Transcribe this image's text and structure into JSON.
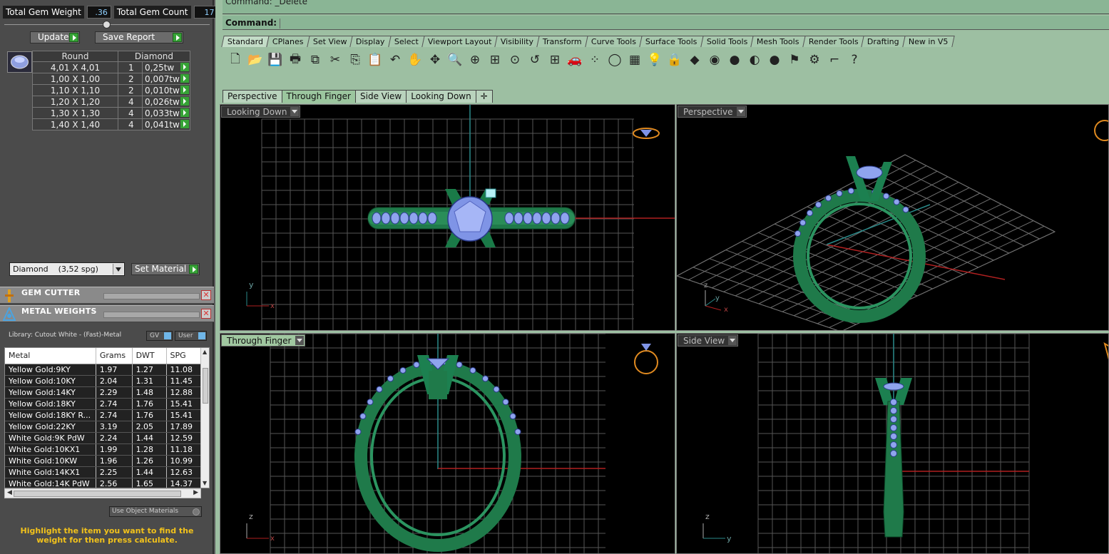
{
  "totals": {
    "weight_label": "Total Gem Weight",
    "weight_value": ".36",
    "count_label": "Total Gem Count",
    "count_value": "17"
  },
  "buttons": {
    "update": "Update",
    "save_report": "Save Report",
    "set_material": "Set Material"
  },
  "gem_table": {
    "headers": [
      "Round",
      "Diamond"
    ],
    "rows": [
      {
        "size": "4,01 X 4,01",
        "count": "1",
        "weight": "0,25tw"
      },
      {
        "size": "1,00 X 1,00",
        "count": "2",
        "weight": "0,007tw"
      },
      {
        "size": "1,10 X 1,10",
        "count": "2",
        "weight": "0,010tw"
      },
      {
        "size": "1,20 X 1,20",
        "count": "4",
        "weight": "0,026tw"
      },
      {
        "size": "1,30 X 1,30",
        "count": "4",
        "weight": "0,033tw"
      },
      {
        "size": "1,40 X 1,40",
        "count": "4",
        "weight": "0,041tw"
      }
    ]
  },
  "material_select": {
    "value": "Diamond    (3,52 spg)"
  },
  "panels": {
    "gem_cutter": "GEM CUTTER",
    "metal_weights": "METAL WEIGHTS"
  },
  "metal": {
    "library": "Library: Cutout White - (Fast)-Metal",
    "gv_label": "GV",
    "user_label": "User",
    "headers": [
      "Metal",
      "Grams",
      "DWT",
      "SPG"
    ],
    "rows": [
      {
        "name": "Yellow Gold:9KY",
        "grams": "1.97",
        "dwt": "1.27",
        "spg": "11.08"
      },
      {
        "name": "Yellow Gold:10KY",
        "grams": "2.04",
        "dwt": "1.31",
        "spg": "11.45"
      },
      {
        "name": "Yellow Gold:14KY",
        "grams": "2.29",
        "dwt": "1.48",
        "spg": "12.88"
      },
      {
        "name": "Yellow Gold:18KY",
        "grams": "2.74",
        "dwt": "1.76",
        "spg": "15.41"
      },
      {
        "name": "Yellow Gold:18KY R...",
        "grams": "2.74",
        "dwt": "1.76",
        "spg": "15.41"
      },
      {
        "name": "Yellow Gold:22KY",
        "grams": "3.19",
        "dwt": "2.05",
        "spg": "17.89"
      },
      {
        "name": "White Gold:9K PdW",
        "grams": "2.24",
        "dwt": "1.44",
        "spg": "12.59"
      },
      {
        "name": "White Gold:10KX1",
        "grams": "1.99",
        "dwt": "1.28",
        "spg": "11.18"
      },
      {
        "name": "White Gold:10KW",
        "grams": "1.96",
        "dwt": "1.26",
        "spg": "10.99"
      },
      {
        "name": "White Gold:14KX1",
        "grams": "2.25",
        "dwt": "1.44",
        "spg": "12.63"
      },
      {
        "name": "White Gold:14K PdW",
        "grams": "2.56",
        "dwt": "1.65",
        "spg": "14.37"
      }
    ],
    "use_object_materials": "Use Object Materials",
    "hint": "Highlight the item you want to find the weight for then press calculate."
  },
  "command": {
    "history": "Command: _Delete",
    "prompt": "Command:"
  },
  "toolbar_tabs": [
    "Standard",
    "CPlanes",
    "Set View",
    "Display",
    "Select",
    "Viewport Layout",
    "Visibility",
    "Transform",
    "Curve Tools",
    "Surface Tools",
    "Solid Tools",
    "Mesh Tools",
    "Render Tools",
    "Drafting",
    "New in V5"
  ],
  "toolbar_icons": [
    "new-file-icon",
    "open-folder-icon",
    "save-icon",
    "print-icon",
    "import-icon",
    "cut-icon",
    "copy-icon",
    "paste-icon",
    "undo-icon",
    "pan-hand-icon",
    "rotate-view-icon",
    "zoom-icon",
    "zoom-window-icon",
    "zoom-extents-icon",
    "zoom-selected-icon",
    "undo-view-icon",
    "four-viewports-icon",
    "car-icon",
    "points-icon",
    "circle-icon",
    "layers-icon",
    "light-icon",
    "lock-icon",
    "properties-icon",
    "color-wheel-icon",
    "shade-icon",
    "render-sphere-icon",
    "blue-sphere-icon",
    "select-filter-icon",
    "options-icon",
    "dimension-icon",
    "help-icon"
  ],
  "toolbar_glyphs": [
    "🗋",
    "📂",
    "💾",
    "🖶",
    "⧉",
    "✂",
    "⎘",
    "📋",
    "↶",
    "✋",
    "✥",
    "🔍",
    "⊕",
    "⊞",
    "⊙",
    "↺",
    "⊞",
    "🚗",
    "⁘",
    "◯",
    "▦",
    "💡",
    "🔒",
    "◆",
    "◉",
    "●",
    "◐",
    "●",
    "⚑",
    "⚙",
    "⌐",
    "?"
  ],
  "viewport_tabs": [
    "Perspective",
    "Through Finger",
    "Side View",
    "Looking Down"
  ],
  "viewports": {
    "top_left": "Looking Down",
    "top_right": "Perspective",
    "bottom_left": "Through Finger",
    "bottom_right": "Side View"
  },
  "axes": {
    "x": "x",
    "y": "y",
    "z": "z"
  },
  "colors": {
    "ring_green": "#1f7a4a",
    "gem_blue": "#8fa4ee",
    "viewport_bg": "#000000",
    "grid": "#5a5a5a",
    "x_axis": "#b02020",
    "y_axis": "#2a8a8a"
  }
}
